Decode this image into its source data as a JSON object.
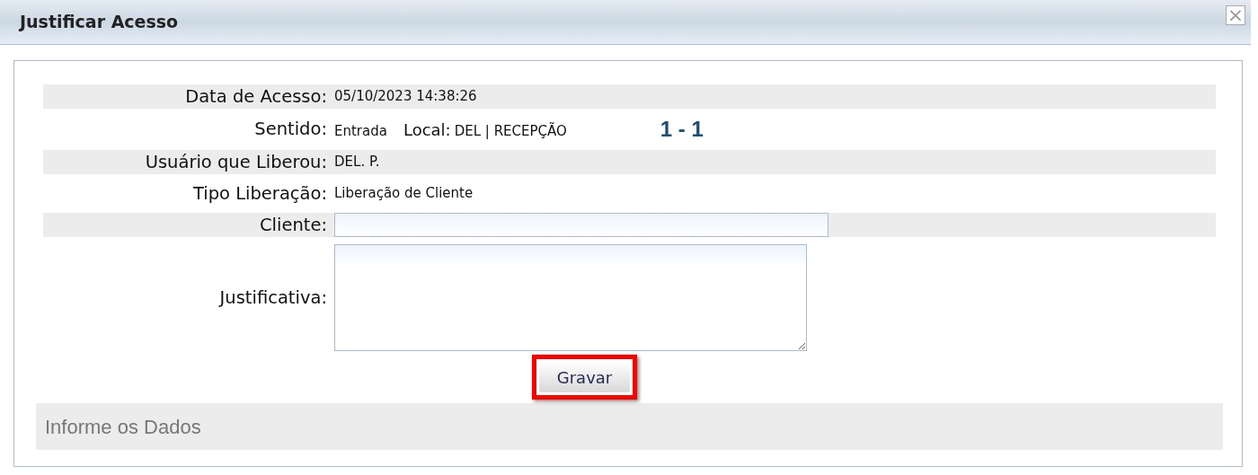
{
  "window": {
    "title": "Justificar Acesso",
    "close": "×"
  },
  "rows": [
    {
      "kind": "text",
      "label": "Data de Acesso:",
      "value": "05/10/2023 14:38:26"
    },
    {
      "kind": "sentido",
      "label": "Sentido:",
      "value": "Entrada",
      "local_label": "Local:",
      "local_value": "DEL | RECEPÇÃO",
      "counter": "1 - 1"
    },
    {
      "kind": "text",
      "label": "Usuário que Liberou:",
      "value": "DEL. P."
    },
    {
      "kind": "text",
      "label": "Tipo Liberação:",
      "value": "Liberação de Cliente"
    },
    {
      "kind": "input",
      "label": "Cliente:",
      "value": ""
    },
    {
      "kind": "textarea",
      "label": "Justificativa:",
      "value": ""
    }
  ],
  "save_button": {
    "label": "Gravar",
    "highlighted": true
  },
  "status_bar": "Informe os Dados"
}
